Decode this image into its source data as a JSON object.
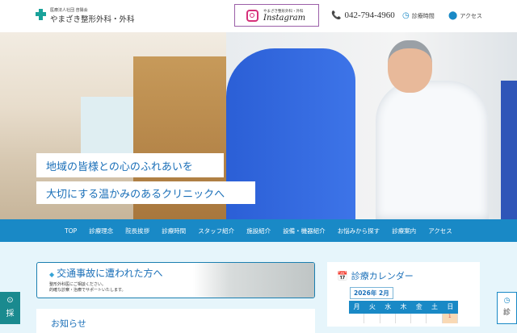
{
  "header": {
    "logo_sub": "医療法人社団 啓陽会",
    "logo_main": "やまざき整形外科・外科",
    "instagram_sub": "やまざき整形外科・外科",
    "instagram_label": "Instagram",
    "phone": "042-794-4960",
    "hours_label": "診療時間",
    "access_label": "アクセス"
  },
  "hero": {
    "slogan_1": "地域の皆様との心のふれあいを",
    "slogan_2": "大切にする温かみのあるクリニックへ"
  },
  "nav": {
    "items": [
      "TOP",
      "診療理念",
      "院長挨拶",
      "診療時間",
      "スタッフ紹介",
      "施設紹介",
      "設備・機器紹介",
      "お悩みから探す",
      "診療案内",
      "アクセス"
    ]
  },
  "accident": {
    "title": "交通事故に遭われた方へ",
    "line1": "整形外科医にご相談ください。",
    "line2": "的確な診察・治療でサポートいたします。"
  },
  "news": {
    "title": "お知らせ"
  },
  "calendar": {
    "title": "診療カレンダー",
    "month": "2026年 2月",
    "weekdays": [
      "月",
      "火",
      "水",
      "木",
      "金",
      "土",
      "日"
    ],
    "first_row": [
      "",
      "",
      "",
      "",
      "",
      "",
      "1"
    ]
  },
  "side": {
    "left_label": "採",
    "right_label": "診"
  },
  "colors": {
    "primary": "#1989c6",
    "accent": "#1a6fb8"
  }
}
